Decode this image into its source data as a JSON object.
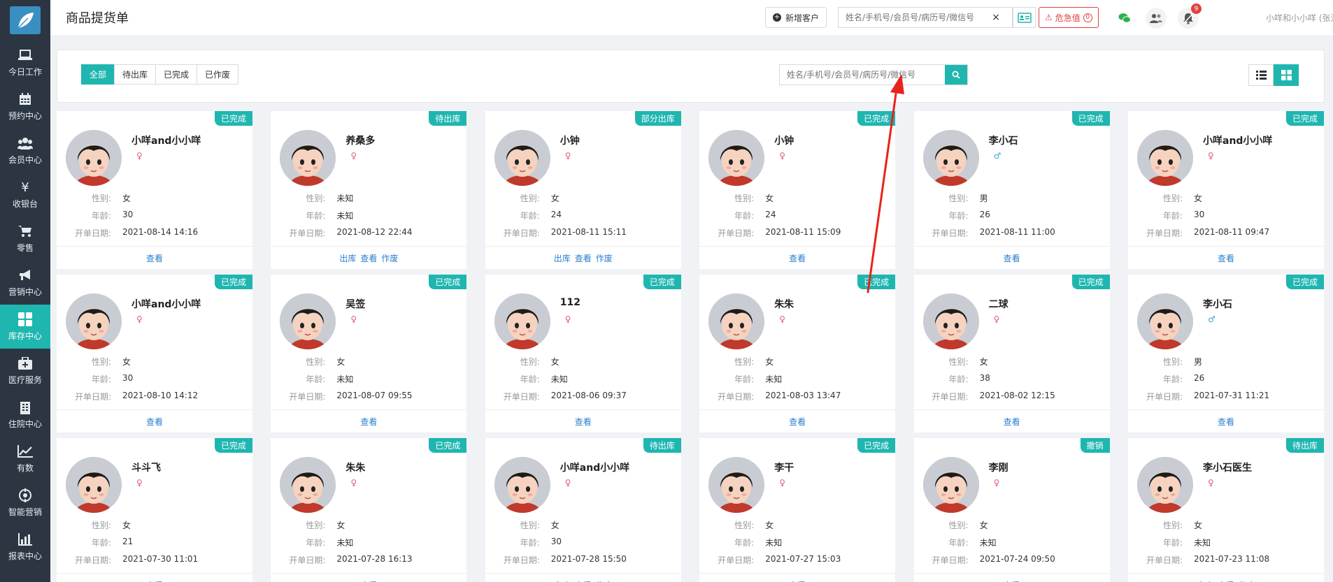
{
  "sidebar": {
    "items": [
      {
        "label": "今日工作",
        "icon": "laptop-icon"
      },
      {
        "label": "预约中心",
        "icon": "calendar-icon"
      },
      {
        "label": "会员中心",
        "icon": "users-icon"
      },
      {
        "label": "收银台",
        "icon": "yen-icon"
      },
      {
        "label": "零售",
        "icon": "cart-icon"
      },
      {
        "label": "营销中心",
        "icon": "megaphone-icon"
      },
      {
        "label": "库存中心",
        "icon": "grid-icon"
      },
      {
        "label": "医疗服务",
        "icon": "medkit-icon"
      },
      {
        "label": "住院中心",
        "icon": "building-icon"
      },
      {
        "label": "有数",
        "icon": "line-chart-icon"
      },
      {
        "label": "智能营销",
        "icon": "target-icon"
      },
      {
        "label": "报表中心",
        "icon": "bar-chart-icon"
      }
    ],
    "active_index": 6
  },
  "header": {
    "title": "商品提货单",
    "new_customer": "新增客户",
    "search_placeholder": "姓名/手机号/会员号/病历号/微信号",
    "clear": "×",
    "danger_label": "危急值",
    "danger_count": "0",
    "notice_badge": "9",
    "user": "小咩和小小咩 (张江门诊部)"
  },
  "filters": {
    "tabs": [
      "全部",
      "待出库",
      "已完成",
      "已作废"
    ],
    "active": 0,
    "search_placeholder": "姓名/手机号/会员号/病历号/微信号"
  },
  "labels": {
    "gender": "性别:",
    "age": "年龄:",
    "date": "开单日期:"
  },
  "cards": [
    {
      "name": "小咩and小小咩",
      "status": "已完成",
      "sex": "f",
      "gender": "女",
      "age": "30",
      "date": "2021-08-14 14:16",
      "actions": [
        "查看"
      ]
    },
    {
      "name": "养桑多",
      "status": "待出库",
      "sex": "f",
      "gender": "未知",
      "age": "未知",
      "date": "2021-08-12 22:44",
      "actions": [
        "出库",
        "查看",
        "作废"
      ]
    },
    {
      "name": "小钟",
      "status": "部分出库",
      "sex": "f",
      "gender": "女",
      "age": "24",
      "date": "2021-08-11 15:11",
      "actions": [
        "出库",
        "查看",
        "作废"
      ]
    },
    {
      "name": "小钟",
      "status": "已完成",
      "sex": "f",
      "gender": "女",
      "age": "24",
      "date": "2021-08-11 15:09",
      "actions": [
        "查看"
      ]
    },
    {
      "name": "李小石",
      "status": "已完成",
      "sex": "m",
      "gender": "男",
      "age": "26",
      "date": "2021-08-11 11:00",
      "actions": [
        "查看"
      ]
    },
    {
      "name": "小咩and小小咩",
      "status": "已完成",
      "sex": "f",
      "gender": "女",
      "age": "30",
      "date": "2021-08-11 09:47",
      "actions": [
        "查看"
      ]
    },
    {
      "name": "小咩and小小咩",
      "status": "已完成",
      "sex": "f",
      "gender": "女",
      "age": "30",
      "date": "2021-08-10 14:12",
      "actions": [
        "查看"
      ]
    },
    {
      "name": "吴签",
      "status": "已完成",
      "sex": "f",
      "gender": "女",
      "age": "未知",
      "date": "2021-08-07 09:55",
      "actions": [
        "查看"
      ]
    },
    {
      "name": "112",
      "status": "已完成",
      "sex": "f",
      "gender": "女",
      "age": "未知",
      "date": "2021-08-06 09:37",
      "actions": [
        "查看"
      ]
    },
    {
      "name": "朱朱",
      "status": "已完成",
      "sex": "f",
      "gender": "女",
      "age": "未知",
      "date": "2021-08-03 13:47",
      "actions": [
        "查看"
      ]
    },
    {
      "name": "二球",
      "status": "已完成",
      "sex": "f",
      "gender": "女",
      "age": "38",
      "date": "2021-08-02 12:15",
      "actions": [
        "查看"
      ]
    },
    {
      "name": "李小石",
      "status": "已完成",
      "sex": "m",
      "gender": "男",
      "age": "26",
      "date": "2021-07-31 11:21",
      "actions": [
        "查看"
      ]
    },
    {
      "name": "斗斗飞",
      "status": "已完成",
      "sex": "f",
      "gender": "女",
      "age": "21",
      "date": "2021-07-30 11:01",
      "actions": [
        "查看"
      ]
    },
    {
      "name": "朱朱",
      "status": "已完成",
      "sex": "f",
      "gender": "女",
      "age": "未知",
      "date": "2021-07-28 16:13",
      "actions": [
        "查看"
      ]
    },
    {
      "name": "小咩and小小咩",
      "status": "待出库",
      "sex": "f",
      "gender": "女",
      "age": "30",
      "date": "2021-07-28 15:50",
      "actions": [
        "出库",
        "查看",
        "作废"
      ]
    },
    {
      "name": "李干",
      "status": "已完成",
      "sex": "f",
      "gender": "女",
      "age": "未知",
      "date": "2021-07-27 15:03",
      "actions": [
        "查看"
      ]
    },
    {
      "name": "李刚",
      "status": "撤销",
      "sex": "f",
      "gender": "女",
      "age": "未知",
      "date": "2021-07-24 09:50",
      "actions": [
        "查看"
      ]
    },
    {
      "name": "李小石医生",
      "status": "待出库",
      "sex": "f",
      "gender": "女",
      "age": "未知",
      "date": "2021-07-23 11:08",
      "actions": [
        "出库",
        "查看",
        "作废"
      ]
    }
  ],
  "colors": {
    "accent": "#1fb6b0",
    "sidebar": "#2c3643",
    "link": "#2a7fcf",
    "danger": "#e14141",
    "annotation": "#e8231b"
  }
}
